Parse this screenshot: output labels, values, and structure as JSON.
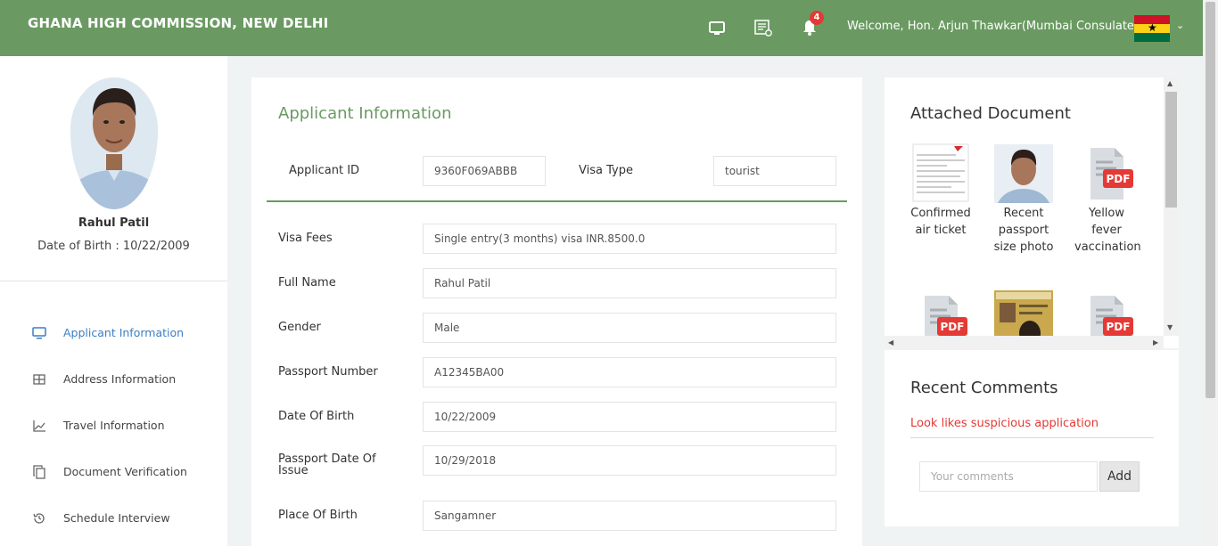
{
  "header": {
    "title": "GHANA HIGH COMMISSION, NEW DELHI",
    "notification_count": "4",
    "welcome": "Welcome, Hon. Arjun Thawkar(Mumbai Consulates)",
    "icons": [
      "monitor-icon",
      "report-icon",
      "bell-icon",
      "ghana-flag-icon",
      "chevron-down-icon"
    ]
  },
  "profile": {
    "name": "Rahul Patil",
    "dob": "Date of Birth : 10/22/2009"
  },
  "nav": {
    "items": [
      {
        "label": "Applicant Information",
        "icon": "monitor-icon",
        "active": true
      },
      {
        "label": "Address Information",
        "icon": "table-icon",
        "active": false
      },
      {
        "label": "Travel Information",
        "icon": "line-chart-icon",
        "active": false
      },
      {
        "label": "Document Verification",
        "icon": "copy-icon",
        "active": false
      },
      {
        "label": "Schedule Interview",
        "icon": "history-icon",
        "active": false
      }
    ]
  },
  "applicant": {
    "section_title": "Applicant Information",
    "id_label": "Applicant ID",
    "id_value": "9360F069ABBB",
    "visa_type_label": "Visa Type",
    "visa_type_value": "tourist",
    "fields": [
      {
        "label": "Visa Fees",
        "value": "Single entry(3 months) visa INR.8500.0"
      },
      {
        "label": "Full Name",
        "value": "Rahul Patil"
      },
      {
        "label": "Gender",
        "value": "Male"
      },
      {
        "label": "Passport Number",
        "value": "A12345BA00"
      },
      {
        "label": "Date Of Birth",
        "value": "10/22/2009"
      },
      {
        "label": "Passport Date Of Issue",
        "value": "10/29/2018"
      },
      {
        "label": "Place Of Birth",
        "value": "Sangamner"
      }
    ]
  },
  "documents": {
    "title": "Attached Document",
    "items": [
      {
        "label": "Confirmed air ticket",
        "kind": "ticket"
      },
      {
        "label": "Recent passport size photo",
        "kind": "photo"
      },
      {
        "label": "Yellow fever vaccination",
        "kind": "pdf"
      },
      {
        "label": "",
        "kind": "pdf"
      },
      {
        "label": "",
        "kind": "id-card"
      },
      {
        "label": "",
        "kind": "pdf"
      }
    ]
  },
  "comments": {
    "title": "Recent Comments",
    "items": [
      "Look likes suspicious application"
    ],
    "placeholder": "Your comments",
    "add_label": "Add"
  },
  "colors": {
    "brand_green": "#6a9a62",
    "active_blue": "#3b7fc4",
    "comment_red": "#e53935",
    "pdf_red": "#e53935"
  }
}
